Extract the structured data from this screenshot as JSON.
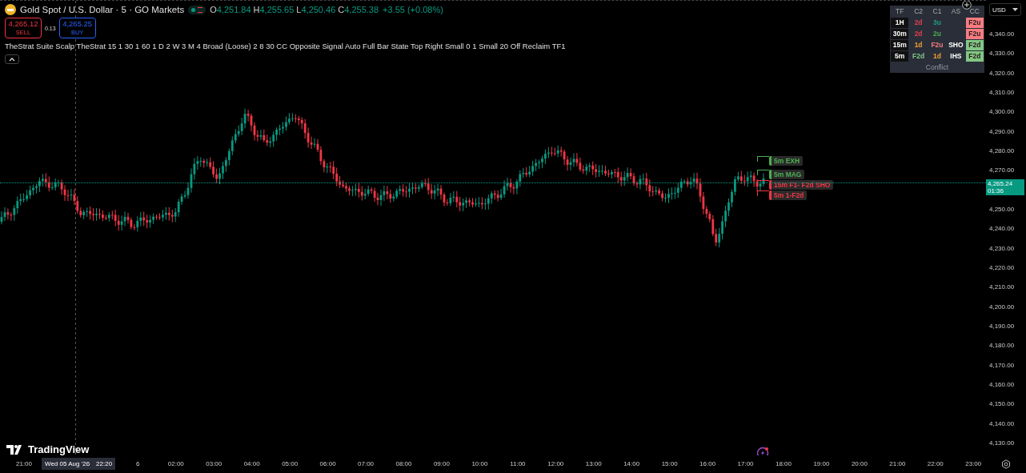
{
  "symbol": {
    "title": "Gold Spot / U.S. Dollar · 5 · GO Markets",
    "market_open": true,
    "ohlc": [
      {
        "label": "O",
        "value": "4,251.84"
      },
      {
        "label": "H",
        "value": "4,255.65"
      },
      {
        "label": "L",
        "value": "4,250.46"
      },
      {
        "label": "C",
        "value": "4,255.38"
      }
    ],
    "change": "+3.55 (+0.08%)"
  },
  "trade": {
    "sell": {
      "price": "4,265.12",
      "label": "SELL"
    },
    "spread": "0.13",
    "buy": {
      "price": "4,265.25",
      "label": "BUY"
    }
  },
  "indicator": "TheStrat Suite Scalp TheStrat 15 1 30 1 60 1 D 2 W 3 M 4 Broad (Loose) 2 8 30 CC Opposite Signal Auto Full Bar State Top Right Small 0 1 Small 20 Off Reclaim TF1",
  "strat_table": {
    "columns": [
      "TF",
      "C2",
      "C1",
      "AS",
      "CC"
    ],
    "rows": [
      [
        {
          "text": "1H",
          "kind": "plain"
        },
        {
          "text": "2d",
          "kind": "colored",
          "color": "#e0404f"
        },
        {
          "text": "3u",
          "kind": "colored",
          "color": "#1e9e86"
        },
        {
          "text": "",
          "kind": "plain"
        },
        {
          "text": "F2u",
          "kind": "filled",
          "color": "#f77c80"
        }
      ],
      [
        {
          "text": "30m",
          "kind": "plain"
        },
        {
          "text": "2d",
          "kind": "colored",
          "color": "#e0404f"
        },
        {
          "text": "2u",
          "kind": "colored",
          "color": "#4caf50"
        },
        {
          "text": "",
          "kind": "plain"
        },
        {
          "text": "F2u",
          "kind": "filled",
          "color": "#f77c80"
        }
      ],
      [
        {
          "text": "15m",
          "kind": "plain"
        },
        {
          "text": "1d",
          "kind": "colored",
          "color": "#f0a030"
        },
        {
          "text": "F2u",
          "kind": "colored",
          "color": "#f77c80"
        },
        {
          "text": "SHO",
          "kind": "plain"
        },
        {
          "text": "F2d",
          "kind": "filled",
          "color": "#81c784"
        }
      ],
      [
        {
          "text": "5m",
          "kind": "plain"
        },
        {
          "text": "F2d",
          "kind": "colored",
          "color": "#81c784"
        },
        {
          "text": "1d",
          "kind": "colored",
          "color": "#f0a030"
        },
        {
          "text": "IHS",
          "kind": "plain"
        },
        {
          "text": "F2d",
          "kind": "filled",
          "color": "#81c784"
        }
      ]
    ],
    "footer": "Conflict"
  },
  "currency": "USD",
  "chart_labels": [
    {
      "text": "5m EXH",
      "color": "#4caf50"
    },
    {
      "text": "5m MAG",
      "color": "#4caf50"
    },
    {
      "text": "15m F1- F2d SHO",
      "color": "#f23645"
    },
    {
      "text": "5m 1-F2d",
      "color": "#f23645"
    }
  ],
  "price_axis": [
    "4,340.00",
    "4,330.00",
    "4,320.00",
    "4,310.00",
    "4,300.00",
    "4,290.00",
    "4,280.00",
    "4,270.00",
    "4,250.00",
    "4,240.00",
    "4,230.00",
    "4,220.00",
    "4,210.00",
    "4,200.00",
    "4,190.00",
    "4,180.00",
    "4,170.00",
    "4,160.00",
    "4,150.00",
    "4,140.00",
    "4,130.00"
  ],
  "current_price": {
    "price": "4,265.24",
    "countdown": "01:36"
  },
  "time_axis": [
    "21:00",
    "6",
    "02:00",
    "03:00",
    "04:00",
    "05:00",
    "06:00",
    "07:00",
    "08:00",
    "09:00",
    "10:00",
    "11:00",
    "12:00",
    "13:00",
    "14:00",
    "15:00",
    "16:00",
    "17:00",
    "18:00",
    "19:00",
    "20:00",
    "21:00",
    "22:00",
    "23:00"
  ],
  "crosshair": {
    "date": "Wed 05 Aug '26",
    "time": "22:20"
  },
  "logo": "TradingView"
}
